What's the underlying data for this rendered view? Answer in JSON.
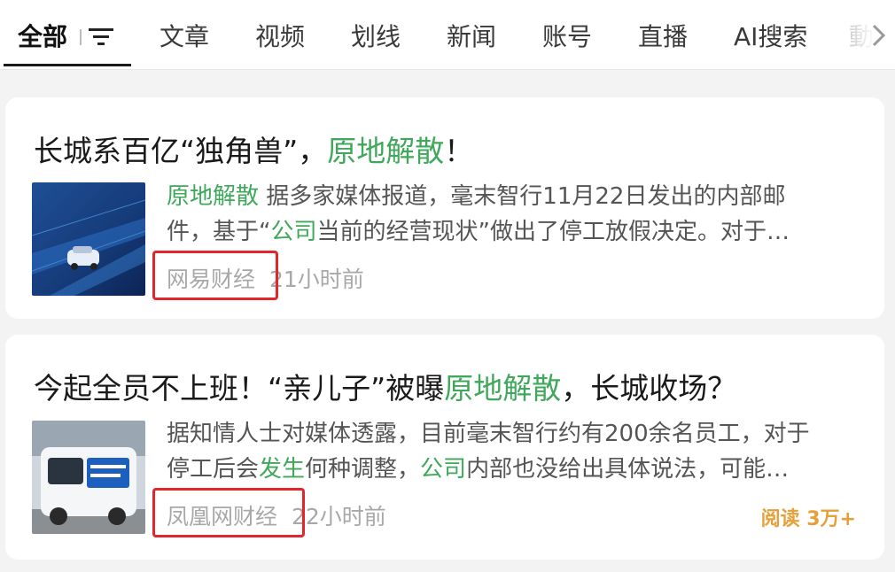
{
  "tabs": [
    {
      "label": "全部",
      "active": true
    },
    {
      "label": "文章"
    },
    {
      "label": "视频"
    },
    {
      "label": "划线"
    },
    {
      "label": "新闻"
    },
    {
      "label": "账号"
    },
    {
      "label": "直播"
    },
    {
      "label": "AI搜索"
    },
    {
      "label": "動"
    }
  ],
  "filter_icon": "filter-lines-icon",
  "scroll_icon": "chevron-right-icon",
  "highlight_color": "#3fa85b",
  "annotation_color": "#e3262b",
  "results": [
    {
      "title_pre": "长城系百亿“独角兽”，",
      "title_hl": "原地解散",
      "title_post": "！",
      "summary_line1_hl": "原地解散",
      "summary_line1_rest": " 据多家媒体报道，毫末智行11月22日发出的内部邮",
      "summary_line2_pre": "件，基于“",
      "summary_line2_hl": "公司",
      "summary_line2_rest": "当前的经营现状”做出了停工放假决定。对于…",
      "source": "网易财经",
      "time": "21小时前"
    },
    {
      "title_pre": "今起全员不上班！“亲儿子”被曝",
      "title_hl": "原地解散",
      "title_post": "，长城收场？",
      "summary_line1": "据知情人士对媒体透露，目前毫末智行约有200余名员工，对于",
      "summary_line2_pre": "停工后会",
      "summary_line2_hl1": "发生",
      "summary_line2_mid": "何种调整，",
      "summary_line2_hl2": "公司",
      "summary_line2_rest": "内部也没给出具体说法，可能…",
      "source": "凤凰网财经",
      "time": "22小时前",
      "reads": "阅读 3万+"
    }
  ]
}
